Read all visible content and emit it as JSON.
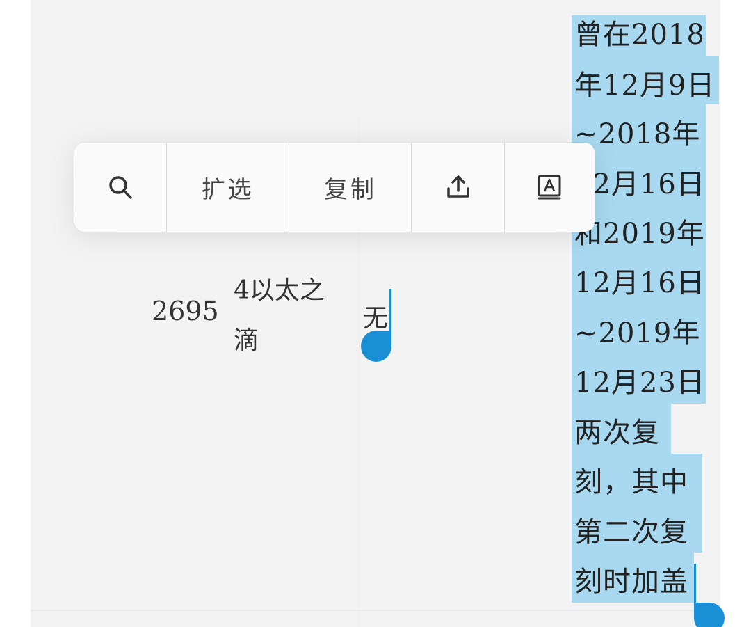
{
  "toolbar": {
    "search_icon": "search-icon",
    "expand_label": "扩选",
    "copy_label": "复制",
    "share_icon": "share-icon",
    "translate_icon": "translate-icon"
  },
  "table_fragment": {
    "number": "2695",
    "middle_line1": "4以太之",
    "middle_line2": "滴",
    "right": "无"
  },
  "selected_text": {
    "lines": [
      "曾在2018",
      "年12月9日",
      "~2018年",
      "12月16日",
      "和2019年",
      "12月16日",
      "~2019年",
      "12月23日",
      "两次复",
      "刻，其中",
      "第二次复",
      "刻时加盖"
    ]
  },
  "colors": {
    "selection": "#a8d9f0",
    "handle": "#1a8fd6",
    "page_bg": "#f3f3f3"
  }
}
